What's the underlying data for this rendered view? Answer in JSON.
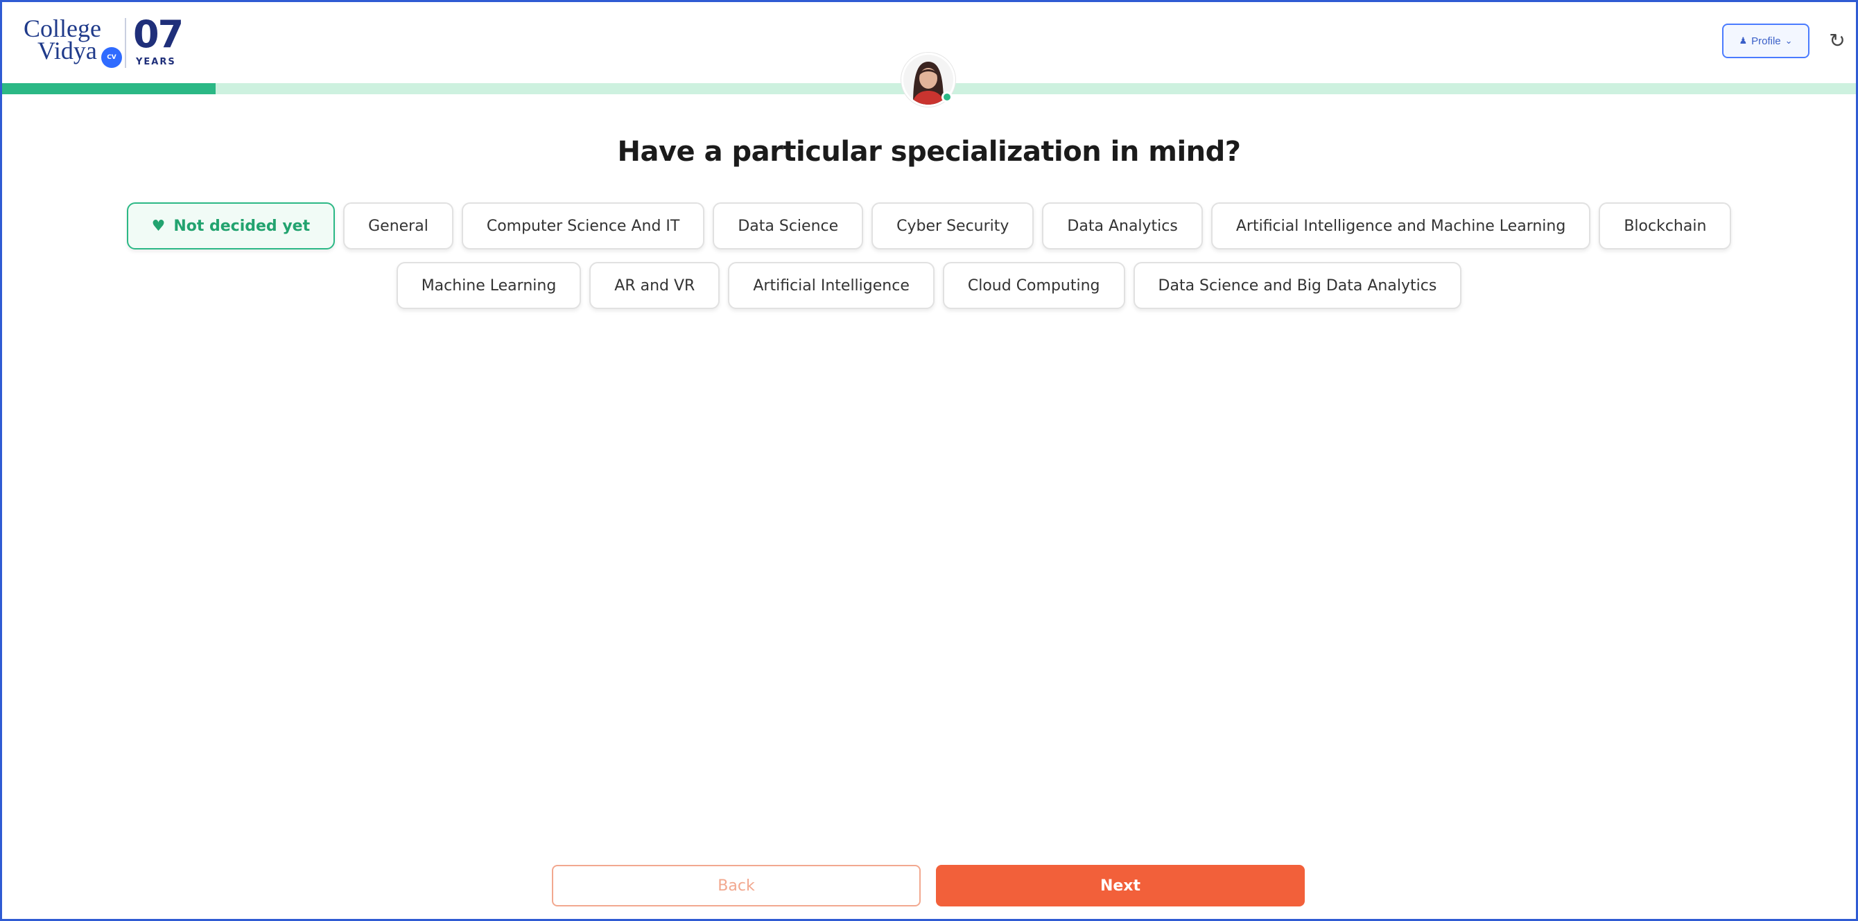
{
  "header": {
    "logo": {
      "line1": "College",
      "line2": "Vidya",
      "badge": "CV",
      "years_number": "07",
      "years_label": "YEARS"
    },
    "profile_button": {
      "icon": "user-icon",
      "label": "Profile",
      "chevron": "chevron-down-icon"
    },
    "refresh_icon": "refresh-icon"
  },
  "progress": {
    "fraction": 0.115,
    "fill_color": "#2bb885",
    "track_color": "#cdf1df"
  },
  "question": "Have a particular specialization in mind?",
  "options_row1": [
    {
      "label": "Not decided yet",
      "selected": true,
      "icon": "heart-icon"
    },
    {
      "label": "General"
    },
    {
      "label": "Computer Science And IT"
    },
    {
      "label": "Data Science"
    },
    {
      "label": "Cyber Security"
    },
    {
      "label": "Data Analytics"
    },
    {
      "label": "Artificial Intelligence and Machine Learning"
    },
    {
      "label": "Blockchain"
    }
  ],
  "options_row2": [
    {
      "label": "Machine Learning"
    },
    {
      "label": "AR and VR"
    },
    {
      "label": "Artificial Intelligence"
    },
    {
      "label": "Cloud Computing"
    },
    {
      "label": "Data Science and Big Data Analytics"
    }
  ],
  "footer": {
    "back_label": "Back",
    "next_label": "Next"
  },
  "colors": {
    "accent_green": "#2bb885",
    "next_orange": "#f2603a",
    "back_outline": "#f2a88f"
  }
}
